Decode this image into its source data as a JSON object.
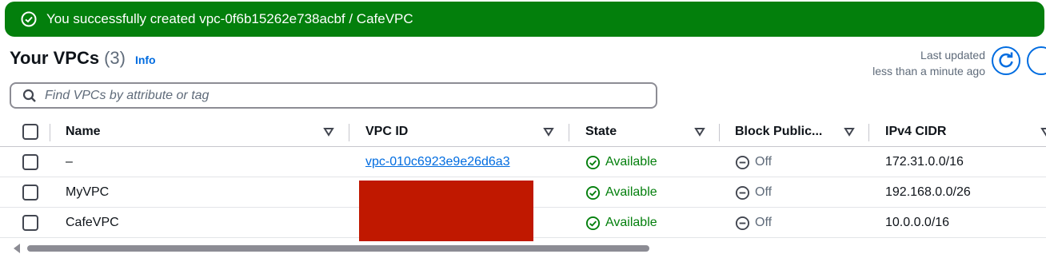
{
  "flash": {
    "message": "You successfully created vpc-0f6b15262e738acbf / CafeVPC",
    "color": "#037f0c"
  },
  "header": {
    "title": "Your VPCs",
    "count": "(3)",
    "info": "Info",
    "last_updated_label": "Last updated",
    "last_updated_value": "less than a minute ago"
  },
  "search": {
    "placeholder": "Find VPCs by attribute or tag",
    "value": ""
  },
  "table": {
    "columns": [
      "Name",
      "VPC ID",
      "State",
      "Block Public...",
      "IPv4 CIDR"
    ],
    "rows": [
      {
        "name": "–",
        "vpc_id": "vpc-010c6923e9e26d6a3",
        "state": "Available",
        "block_public": "Off",
        "ipv4_cidr": "172.31.0.0/16"
      },
      {
        "name": "MyVPC",
        "vpc_id": "",
        "state": "Available",
        "block_public": "Off",
        "ipv4_cidr": "192.168.0.0/26"
      },
      {
        "name": "CafeVPC",
        "vpc_id": "",
        "state": "Available",
        "block_public": "Off",
        "ipv4_cidr": "10.0.0.0/16"
      }
    ]
  },
  "colors": {
    "accent": "#006ce0",
    "success": "#037f0c",
    "redaction": "#c01800"
  }
}
